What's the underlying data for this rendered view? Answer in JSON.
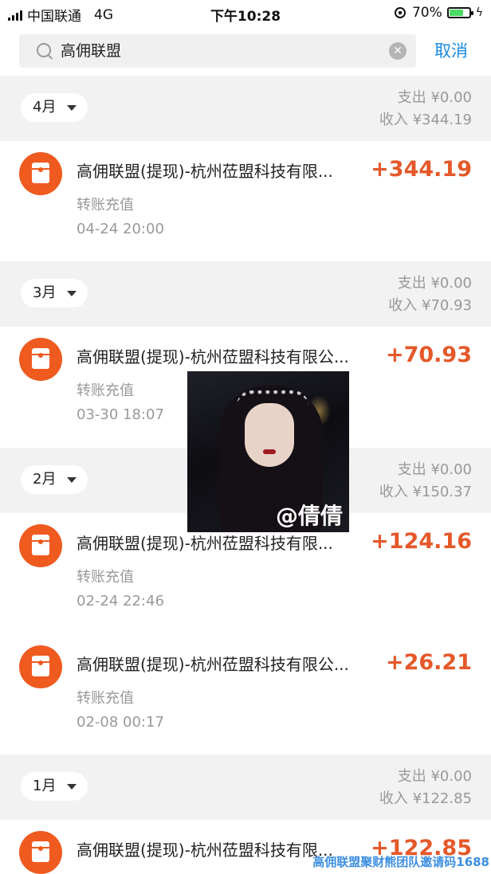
{
  "status_bar": {
    "carrier": "中国联通",
    "network": "4G",
    "time": "下午10:28",
    "battery": "70%",
    "battery_level": 0.7
  },
  "search": {
    "value": "高佣联盟",
    "cancel_label": "取消"
  },
  "months": [
    {
      "label": "4月",
      "expense": "支出 ¥0.00",
      "income": "收入 ¥344.19"
    },
    {
      "label": "3月",
      "expense": "支出 ¥0.00",
      "income": "收入 ¥70.93"
    },
    {
      "label": "2月",
      "expense": "支出 ¥0.00",
      "income": "收入 ¥150.37"
    },
    {
      "label": "1月",
      "expense": "支出 ¥0.00",
      "income": "收入 ¥122.85"
    }
  ],
  "transactions": [
    {
      "title": "高佣联盟(提现)-杭州莅盟科技有限...",
      "amount": "+344.19",
      "type": "转账充值",
      "time": "04-24  20:00"
    },
    {
      "title": "高佣联盟(提现)-杭州莅盟科技有限公...",
      "amount": "+70.93",
      "type": "转账充值",
      "time": "03-30  18:07"
    },
    {
      "title": "高佣联盟(提现)-杭州莅盟科技有限...",
      "amount": "+124.16",
      "type": "转账充值",
      "time": "02-24  22:46"
    },
    {
      "title": "高佣联盟(提现)-杭州莅盟科技有限公...",
      "amount": "+26.21",
      "type": "转账充值",
      "time": "02-08  00:17"
    },
    {
      "title": "高佣联盟(提现)-杭州莅盟科技有限...",
      "amount": "+122.85",
      "type": "",
      "time": ""
    }
  ],
  "overlay": {
    "caption": "@倩倩"
  },
  "watermark": "高佣联盟聚财熊团队邀请码1688",
  "colors": {
    "accent_blue": "#1a8ae0",
    "amount_orange": "#e5582a",
    "icon_orange": "#ef5a1f"
  }
}
